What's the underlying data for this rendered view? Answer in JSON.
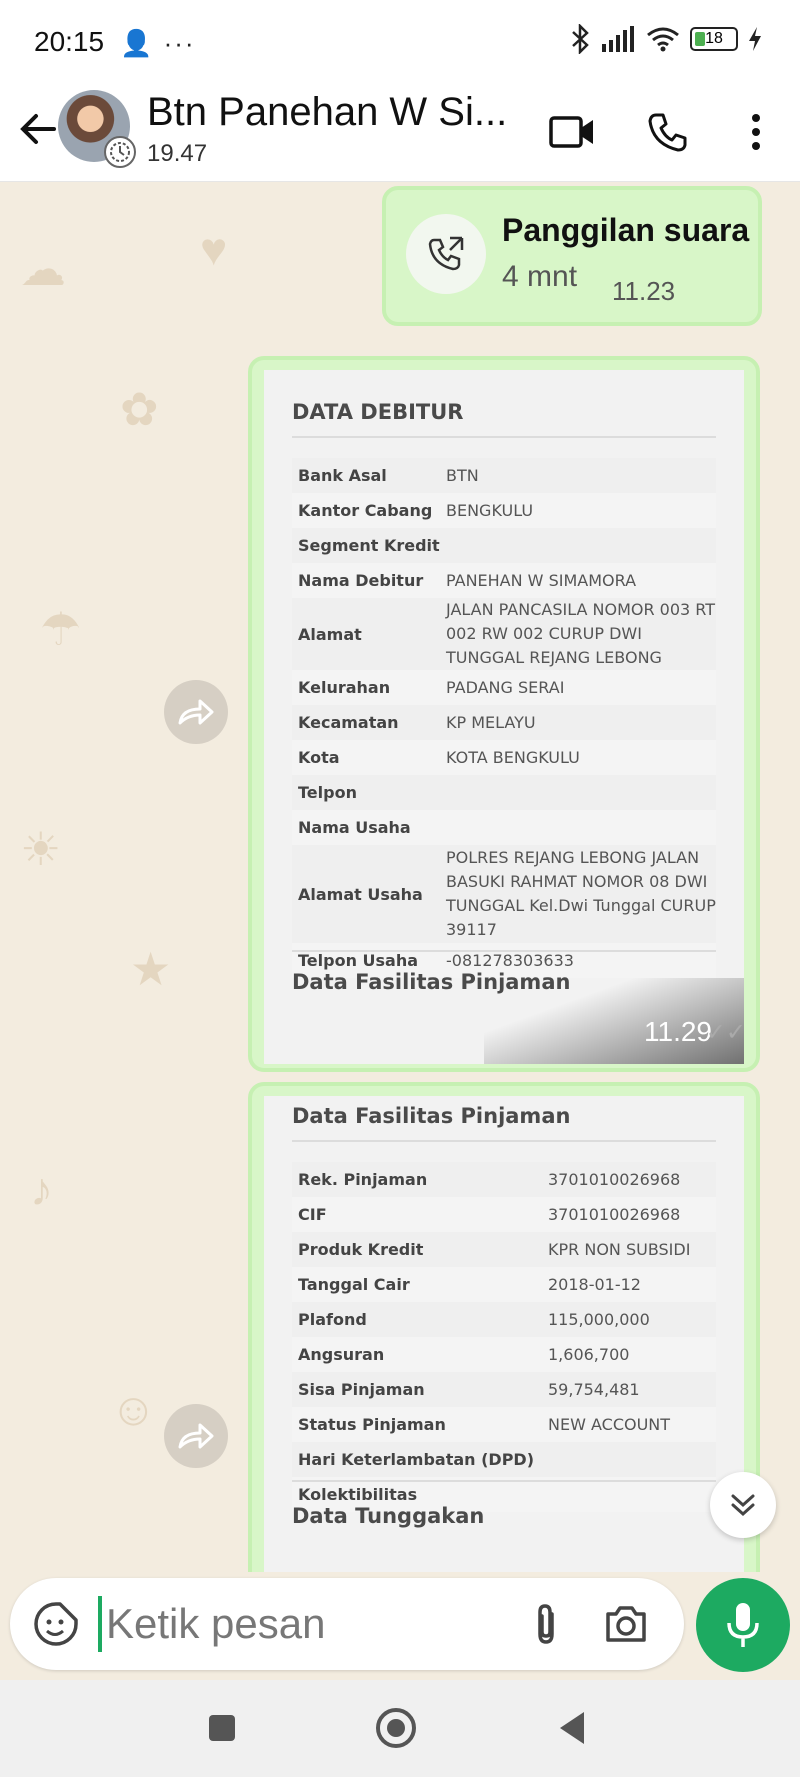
{
  "status_bar": {
    "time": "20:15",
    "left_icons": "👤 ···",
    "battery": "18"
  },
  "header": {
    "contact_name": "Btn Panehan W Si...",
    "subtitle": "19.47"
  },
  "call_message": {
    "title": "Panggilan suara",
    "duration": "4 mnt",
    "time": "11.23"
  },
  "debitur": {
    "title": "DATA DEBITUR",
    "rows": [
      {
        "label": "Bank Asal",
        "value": "BTN"
      },
      {
        "label": "Kantor Cabang",
        "value": "BENGKULU"
      },
      {
        "label": "Segment Kredit",
        "value": ""
      },
      {
        "label": "Nama Debitur",
        "value": "PANEHAN W SIMAMORA"
      },
      {
        "label": "Alamat",
        "value": "JALAN PANCASILA NOMOR 003 RT 002 RW 002 CURUP DWI TUNGGAL REJANG LEBONG"
      },
      {
        "label": "Kelurahan",
        "value": "PADANG SERAI"
      },
      {
        "label": "Kecamatan",
        "value": "KP MELAYU"
      },
      {
        "label": "Kota",
        "value": "KOTA BENGKULU"
      },
      {
        "label": "Telpon",
        "value": ""
      },
      {
        "label": "Nama Usaha",
        "value": ""
      },
      {
        "label": "Alamat Usaha",
        "value": "POLRES REJANG LEBONG JALAN BASUKI RAHMAT NOMOR 08 DWI TUNGGAL Kel.Dwi Tunggal CURUP 39117"
      },
      {
        "label": "Telpon Usaha",
        "value": "-081278303633"
      }
    ],
    "next_section": "Data Fasilitas Pinjaman",
    "time": "11.29",
    "ticks": "✓✓"
  },
  "fasilitas": {
    "title": "Data Fasilitas Pinjaman",
    "rows": [
      {
        "label": "Rek. Pinjaman",
        "value": "3701010026968"
      },
      {
        "label": "CIF",
        "value": "3701010026968"
      },
      {
        "label": "Produk Kredit",
        "value": "KPR NON SUBSIDI"
      },
      {
        "label": "Tanggal Cair",
        "value": "2018-01-12"
      },
      {
        "label": "Plafond",
        "value": "115,000,000"
      },
      {
        "label": "Angsuran",
        "value": "1,606,700"
      },
      {
        "label": "Sisa Pinjaman",
        "value": "59,754,481"
      },
      {
        "label": "Status Pinjaman",
        "value": "NEW ACCOUNT"
      },
      {
        "label": "Hari Keterlambatan (DPD)",
        "value": ""
      },
      {
        "label": "Kolektibilitas",
        "value": ""
      }
    ],
    "next_section": "Data Tunggakan"
  },
  "input": {
    "placeholder": "Ketik pesan"
  },
  "icons": {
    "back": "back-arrow-icon",
    "video": "video-call-icon",
    "phone": "phone-icon",
    "menu": "more-vert-icon",
    "forward": "forward-icon",
    "emoji": "sticker-icon",
    "attach": "paperclip-icon",
    "camera": "camera-icon",
    "mic": "mic-icon"
  },
  "colors": {
    "accent": "#1daa61",
    "bubble_out": "#d8f6c8",
    "wallpaper": "#f3ecdf"
  }
}
